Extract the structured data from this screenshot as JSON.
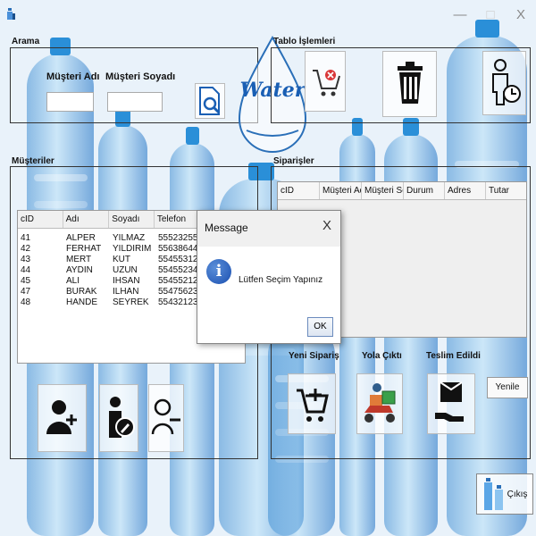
{
  "window": {
    "minimize_glyph": "—",
    "maximize_glyph": "□",
    "close_glyph": "X"
  },
  "search": {
    "panel_label": "Arama",
    "first_name_label": "Müşteri Adı",
    "last_name_label": "Müşteri Soyadı",
    "first_name_value": "",
    "last_name_value": ""
  },
  "table_ops": {
    "panel_label": "Tablo İşlemleri"
  },
  "logo_text": "Water",
  "customers": {
    "panel_label": "Müşteriler",
    "columns": [
      "cID",
      "Adı",
      "Soyadı",
      "Telefon"
    ],
    "rows": [
      [
        "41",
        "ALPER",
        "YILMAZ",
        "5552325563"
      ],
      [
        "42",
        "FERHAT",
        "YILDIRIM",
        "5563864444"
      ],
      [
        "43",
        "MERT",
        "KUT",
        "5545531248"
      ],
      [
        "44",
        "AYDIN",
        "UZUN",
        "5545523422"
      ],
      [
        "45",
        "ALİ",
        "İHSAN",
        "5545521211"
      ],
      [
        "47",
        "BURAK",
        "İLHAN",
        "554756231"
      ],
      [
        "48",
        "HANDE",
        "SEYREK",
        "55432123"
      ]
    ]
  },
  "orders": {
    "panel_label": "Siparişler",
    "columns": [
      "cID",
      "Müşteri Adı",
      "Müşteri So...",
      "Durum",
      "Adres",
      "Tutar"
    ],
    "new_order_label": "Yeni Sipariş",
    "on_road_label": "Yola Çıktı",
    "delivered_label": "Teslim Edildi",
    "refresh_label": "Yenile"
  },
  "exit_label": "Çıkış",
  "dialog": {
    "title": "Message",
    "close_glyph": "X",
    "message": "Lütfen Seçim Yapınız",
    "ok_label": "OK",
    "icon_glyph": "i"
  },
  "colors": {
    "accent_blue": "#1a5fb4",
    "panel_border": "#333333"
  }
}
